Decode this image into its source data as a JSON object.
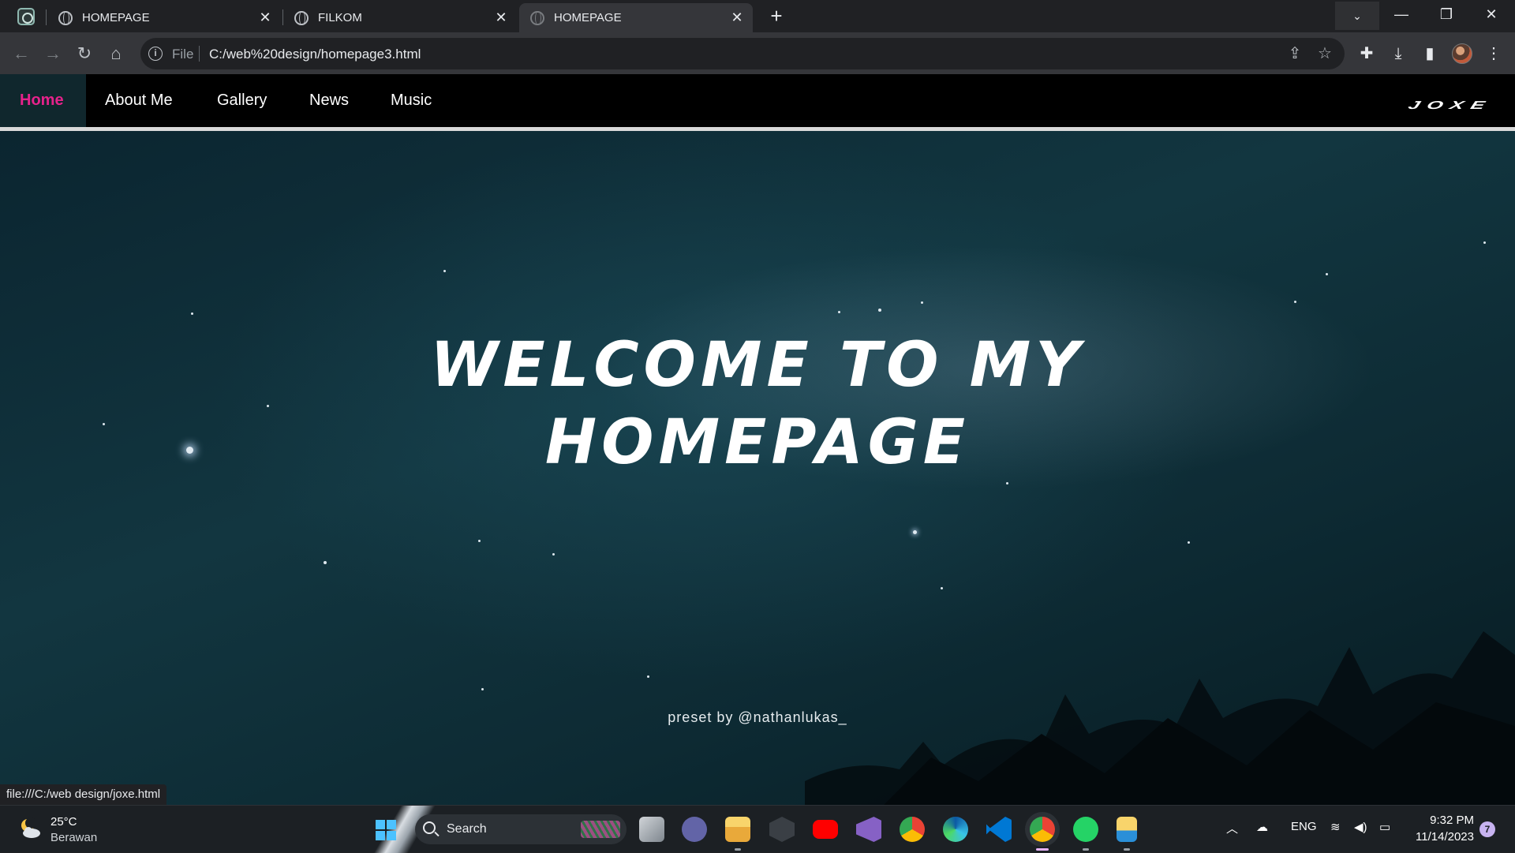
{
  "browser": {
    "tabs": [
      {
        "label": "HOMEPAGE",
        "active": false
      },
      {
        "label": "FILKOM",
        "active": false
      },
      {
        "label": "HOMEPAGE",
        "active": true
      }
    ],
    "new_tab": "+",
    "close_glyph": "✕",
    "window_controls": {
      "tab_search": "⌄",
      "minimize": "—",
      "restore": "❐",
      "close": "✕"
    },
    "address": {
      "scheme_label": "File",
      "url": "C:/web%20design/homepage3.html"
    }
  },
  "page": {
    "nav": {
      "items": [
        {
          "label": "Home",
          "active": true
        },
        {
          "label": "About Me",
          "active": false
        },
        {
          "label": "Gallery",
          "active": false
        },
        {
          "label": "News",
          "active": false
        },
        {
          "label": "Music",
          "active": false
        }
      ],
      "brand": "JOXE"
    },
    "hero": {
      "title_line1": "WELCOME TO MY",
      "title_line2": "HOMEPAGE",
      "credit": "preset by @nathanlukas_"
    },
    "status_url": "file:///C:/web design/joxe.html",
    "colors": {
      "active_nav": "#e6228b",
      "navbar_bg": "#000000",
      "hero_bg": "#0d2a33"
    }
  },
  "taskbar": {
    "weather": {
      "temp": "25°C",
      "desc": "Berawan"
    },
    "search_label": "Search",
    "apps": [
      "task-view-icon",
      "teams-icon",
      "file-explorer-icon",
      "app-icon",
      "youtube-icon",
      "visual-studio-icon",
      "chrome-icon",
      "edge-icon",
      "vscode-icon",
      "chrome-active-icon",
      "whatsapp-icon",
      "file-manager-icon"
    ],
    "tray": {
      "language": "ENG"
    },
    "clock": {
      "time": "9:32 PM",
      "date": "11/14/2023"
    },
    "notifications": "7"
  }
}
